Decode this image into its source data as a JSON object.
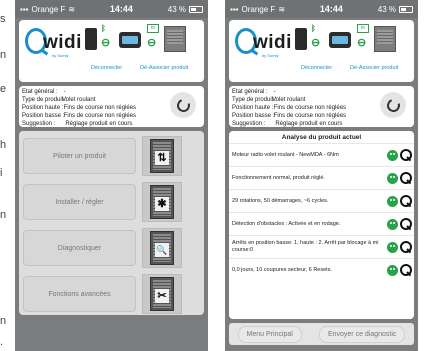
{
  "side_letters": [
    "s",
    "n",
    "e",
    "h",
    "i",
    "n",
    "n",
    "."
  ],
  "status_bar": {
    "carrier": "Orange F",
    "time": "14:44",
    "battery": "43 %"
  },
  "header": {
    "brand": "widi",
    "brand_sub": "by Somfy",
    "disconnect": "Déconnecter",
    "dissociate": "Dé-Associer produit"
  },
  "status": {
    "rows": [
      {
        "k": "Etat général :",
        "v": "-"
      },
      {
        "k": "Type de produit :",
        "v": "Volet roulant"
      },
      {
        "k": "Position haute :",
        "v": "Fins de course non réglées"
      },
      {
        "k": "Position basse :",
        "v": "Fins de course non réglées"
      },
      {
        "k": "Suggestion :",
        "v": "Réglage produit en cours"
      }
    ]
  },
  "menu": {
    "items": [
      {
        "label": "Piloter un produit",
        "glyph": "⇅",
        "icon": "updown-icon"
      },
      {
        "label": "Installer / régler",
        "glyph": "✱",
        "icon": "gear-icon"
      },
      {
        "label": "Diagnostiquer",
        "glyph": "🔍",
        "icon": "magnifier-icon"
      },
      {
        "label": "Fonctions avancées",
        "glyph": "✂",
        "icon": "tools-icon"
      }
    ]
  },
  "analysis": {
    "title": "Analyse du produit actuel",
    "rows": [
      "Moteur radio volet roulant - NewMDA -  6Nm",
      "Fonctionnement normal, produit réglé.",
      "29 rotations, 50 démarrages, ~6 cycles.",
      "Détection d'obstacles : Activée et en rodage.",
      "Arrêts en position basse: 1, haute : 2. Arrêt par blocage à mi course:0",
      "0,0 jours, 10 coupures secteur, 6 Resets."
    ]
  },
  "footer": {
    "main_menu": "Menu Principal",
    "send_diag": "Envoyer ce diagnostic"
  }
}
